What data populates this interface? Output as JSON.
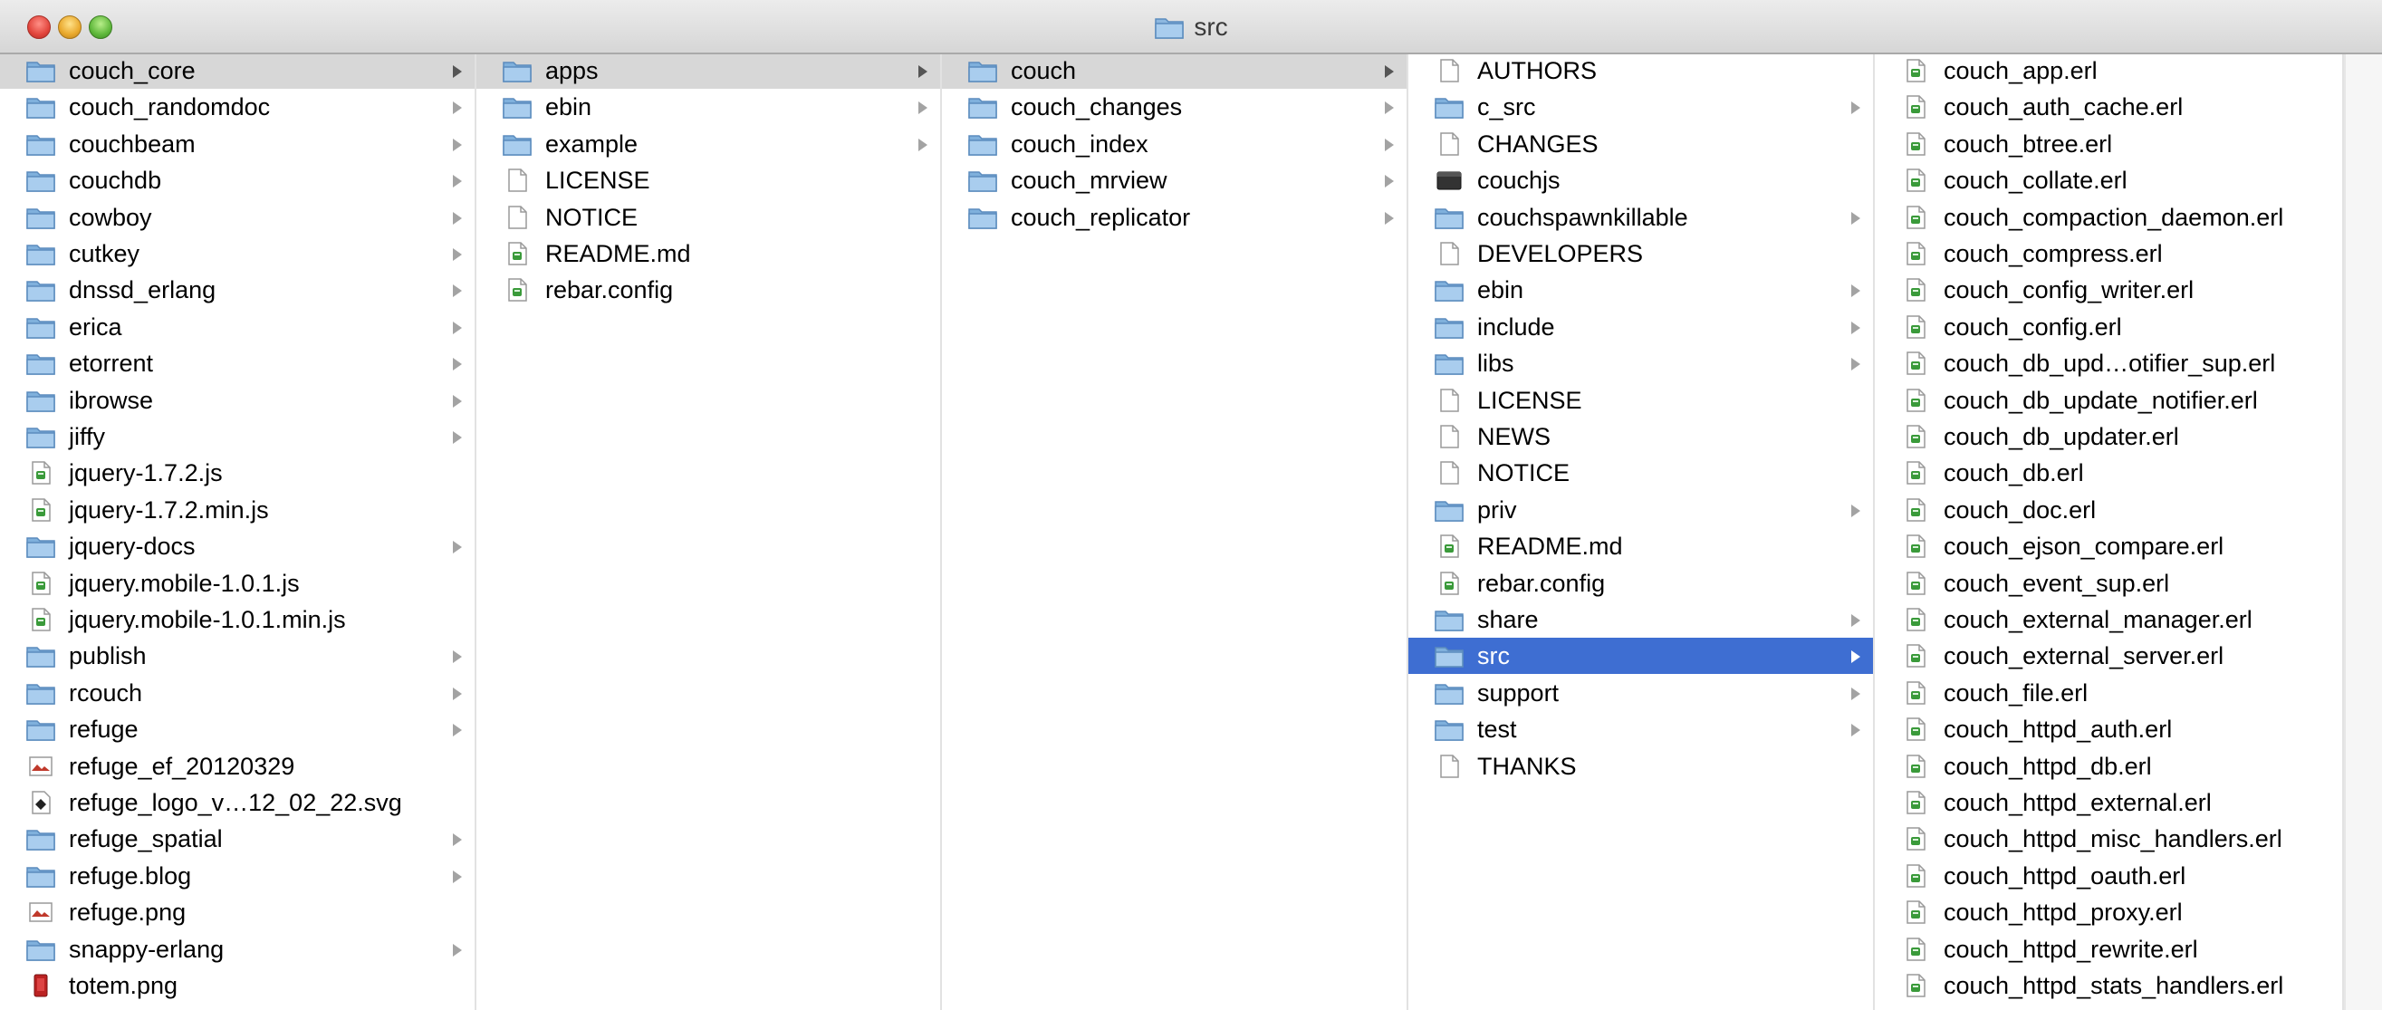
{
  "window": {
    "title": "src",
    "colors": {
      "selection": "#3e6ed2",
      "path_highlight": "#d7d7d7",
      "folder": "#8db8e0"
    }
  },
  "columns": [
    {
      "items": [
        {
          "label": "couch_core",
          "icon": "folder-icon",
          "arrow": true,
          "state": "active"
        },
        {
          "label": "couch_randomdoc",
          "icon": "folder-icon",
          "arrow": true
        },
        {
          "label": "couchbeam",
          "icon": "folder-icon",
          "arrow": true
        },
        {
          "label": "couchdb",
          "icon": "folder-icon",
          "arrow": true
        },
        {
          "label": "cowboy",
          "icon": "folder-icon",
          "arrow": true
        },
        {
          "label": "cutkey",
          "icon": "folder-icon",
          "arrow": true
        },
        {
          "label": "dnssd_erlang",
          "icon": "folder-icon",
          "arrow": true
        },
        {
          "label": "erica",
          "icon": "folder-icon",
          "arrow": true
        },
        {
          "label": "etorrent",
          "icon": "folder-icon",
          "arrow": true
        },
        {
          "label": "ibrowse",
          "icon": "folder-icon",
          "arrow": true
        },
        {
          "label": "jiffy",
          "icon": "folder-icon",
          "arrow": true
        },
        {
          "label": "jquery-1.7.2.js",
          "icon": "script-file-icon"
        },
        {
          "label": "jquery-1.7.2.min.js",
          "icon": "script-file-icon"
        },
        {
          "label": "jquery-docs",
          "icon": "folder-icon",
          "arrow": true
        },
        {
          "label": "jquery.mobile-1.0.1.js",
          "icon": "script-file-icon"
        },
        {
          "label": "jquery.mobile-1.0.1.min.js",
          "icon": "script-file-icon"
        },
        {
          "label": "publish",
          "icon": "folder-icon",
          "arrow": true
        },
        {
          "label": "rcouch",
          "icon": "folder-icon",
          "arrow": true
        },
        {
          "label": "refuge",
          "icon": "folder-icon",
          "arrow": true
        },
        {
          "label": "refuge_ef_20120329",
          "icon": "image-file-icon"
        },
        {
          "label": "refuge_logo_v…12_02_22.svg",
          "icon": "svg-file-icon"
        },
        {
          "label": "refuge_spatial",
          "icon": "folder-icon",
          "arrow": true
        },
        {
          "label": "refuge.blog",
          "icon": "folder-icon",
          "arrow": true
        },
        {
          "label": "refuge.png",
          "icon": "image-file-icon"
        },
        {
          "label": "snappy-erlang",
          "icon": "folder-icon",
          "arrow": true
        },
        {
          "label": "totem.png",
          "icon": "red-image-icon"
        }
      ]
    },
    {
      "items": [
        {
          "label": "apps",
          "icon": "folder-icon",
          "arrow": true,
          "state": "active"
        },
        {
          "label": "ebin",
          "icon": "folder-icon",
          "arrow": true
        },
        {
          "label": "example",
          "icon": "folder-icon",
          "arrow": true
        },
        {
          "label": "LICENSE",
          "icon": "document-icon"
        },
        {
          "label": "NOTICE",
          "icon": "document-icon"
        },
        {
          "label": "README.md",
          "icon": "script-file-icon"
        },
        {
          "label": "rebar.config",
          "icon": "script-file-icon"
        }
      ]
    },
    {
      "items": [
        {
          "label": "couch",
          "icon": "folder-icon",
          "arrow": true,
          "state": "active"
        },
        {
          "label": "couch_changes",
          "icon": "folder-icon",
          "arrow": true
        },
        {
          "label": "couch_index",
          "icon": "folder-icon",
          "arrow": true
        },
        {
          "label": "couch_mrview",
          "icon": "folder-icon",
          "arrow": true
        },
        {
          "label": "couch_replicator",
          "icon": "folder-icon",
          "arrow": true
        }
      ]
    },
    {
      "items": [
        {
          "label": "AUTHORS",
          "icon": "document-icon"
        },
        {
          "label": "c_src",
          "icon": "folder-icon",
          "arrow": true
        },
        {
          "label": "CHANGES",
          "icon": "document-icon"
        },
        {
          "label": "couchjs",
          "icon": "executable-icon"
        },
        {
          "label": "couchspawnkillable",
          "icon": "folder-icon",
          "arrow": true
        },
        {
          "label": "DEVELOPERS",
          "icon": "document-icon"
        },
        {
          "label": "ebin",
          "icon": "folder-icon",
          "arrow": true
        },
        {
          "label": "include",
          "icon": "folder-icon",
          "arrow": true
        },
        {
          "label": "libs",
          "icon": "folder-icon",
          "arrow": true
        },
        {
          "label": "LICENSE",
          "icon": "document-icon"
        },
        {
          "label": "NEWS",
          "icon": "document-icon"
        },
        {
          "label": "NOTICE",
          "icon": "document-icon"
        },
        {
          "label": "priv",
          "icon": "folder-icon",
          "arrow": true
        },
        {
          "label": "README.md",
          "icon": "script-file-icon"
        },
        {
          "label": "rebar.config",
          "icon": "script-file-icon"
        },
        {
          "label": "share",
          "icon": "folder-icon",
          "arrow": true
        },
        {
          "label": "src",
          "icon": "folder-icon",
          "arrow": true,
          "state": "selected"
        },
        {
          "label": "support",
          "icon": "folder-icon",
          "arrow": true
        },
        {
          "label": "test",
          "icon": "folder-icon",
          "arrow": true
        },
        {
          "label": "THANKS",
          "icon": "document-icon"
        }
      ]
    },
    {
      "items": [
        {
          "label": "couch_app.erl",
          "icon": "script-file-icon"
        },
        {
          "label": "couch_auth_cache.erl",
          "icon": "script-file-icon"
        },
        {
          "label": "couch_btree.erl",
          "icon": "script-file-icon"
        },
        {
          "label": "couch_collate.erl",
          "icon": "script-file-icon"
        },
        {
          "label": "couch_compaction_daemon.erl",
          "icon": "script-file-icon"
        },
        {
          "label": "couch_compress.erl",
          "icon": "script-file-icon"
        },
        {
          "label": "couch_config_writer.erl",
          "icon": "script-file-icon"
        },
        {
          "label": "couch_config.erl",
          "icon": "script-file-icon"
        },
        {
          "label": "couch_db_upd…otifier_sup.erl",
          "icon": "script-file-icon"
        },
        {
          "label": "couch_db_update_notifier.erl",
          "icon": "script-file-icon"
        },
        {
          "label": "couch_db_updater.erl",
          "icon": "script-file-icon"
        },
        {
          "label": "couch_db.erl",
          "icon": "script-file-icon"
        },
        {
          "label": "couch_doc.erl",
          "icon": "script-file-icon"
        },
        {
          "label": "couch_ejson_compare.erl",
          "icon": "script-file-icon"
        },
        {
          "label": "couch_event_sup.erl",
          "icon": "script-file-icon"
        },
        {
          "label": "couch_external_manager.erl",
          "icon": "script-file-icon"
        },
        {
          "label": "couch_external_server.erl",
          "icon": "script-file-icon"
        },
        {
          "label": "couch_file.erl",
          "icon": "script-file-icon"
        },
        {
          "label": "couch_httpd_auth.erl",
          "icon": "script-file-icon"
        },
        {
          "label": "couch_httpd_db.erl",
          "icon": "script-file-icon"
        },
        {
          "label": "couch_httpd_external.erl",
          "icon": "script-file-icon"
        },
        {
          "label": "couch_httpd_misc_handlers.erl",
          "icon": "script-file-icon"
        },
        {
          "label": "couch_httpd_oauth.erl",
          "icon": "script-file-icon"
        },
        {
          "label": "couch_httpd_proxy.erl",
          "icon": "script-file-icon"
        },
        {
          "label": "couch_httpd_rewrite.erl",
          "icon": "script-file-icon"
        },
        {
          "label": "couch_httpd_stats_handlers.erl",
          "icon": "script-file-icon"
        }
      ]
    }
  ]
}
